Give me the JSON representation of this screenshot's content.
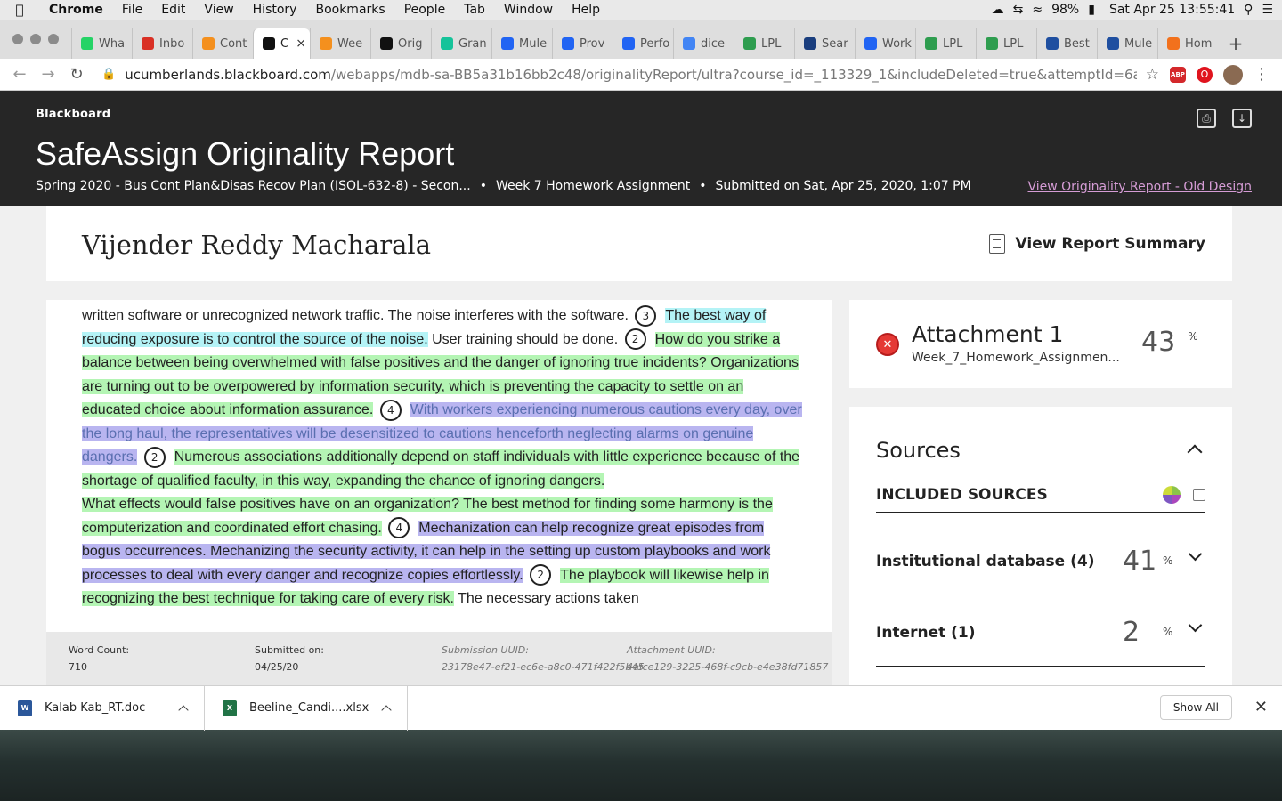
{
  "menubar": {
    "app": "Chrome",
    "items": [
      "File",
      "Edit",
      "View",
      "History",
      "Bookmarks",
      "People",
      "Tab",
      "Window",
      "Help"
    ],
    "battery": "98%",
    "datetime": "Sat Apr 25  13:55:41"
  },
  "tabs": [
    {
      "label": "Wha",
      "icon": "whatsapp-icon",
      "color": "#25d366"
    },
    {
      "label": "Inbo",
      "icon": "gmail-icon",
      "color": "#d93025"
    },
    {
      "label": "Cont",
      "icon": "pencil-icon",
      "color": "#f4901e"
    },
    {
      "label": "C",
      "icon": "blackboard-icon",
      "color": "#111",
      "active": true
    },
    {
      "label": "Wee",
      "icon": "pencil-icon",
      "color": "#f4901e"
    },
    {
      "label": "Orig",
      "icon": "blackboard-icon",
      "color": "#111"
    },
    {
      "label": "Gran",
      "icon": "grammarly-icon",
      "color": "#15c39a"
    },
    {
      "label": "Mule",
      "icon": "indeed-icon",
      "color": "#2164f3"
    },
    {
      "label": "Prov",
      "icon": "indeed-icon",
      "color": "#2164f3"
    },
    {
      "label": "Perfo",
      "icon": "indeed-icon",
      "color": "#2164f3"
    },
    {
      "label": "dice",
      "icon": "google-icon",
      "color": "#4285f4"
    },
    {
      "label": "LPL",
      "icon": "lpl-icon",
      "color": "#2e9d4f"
    },
    {
      "label": "Sear",
      "icon": "chart-icon",
      "color": "#1a3e7e"
    },
    {
      "label": "Work",
      "icon": "indeed-icon",
      "color": "#2164f3"
    },
    {
      "label": "LPL",
      "icon": "lpl-icon",
      "color": "#2e9d4f"
    },
    {
      "label": "LPL",
      "icon": "lpl-icon",
      "color": "#2e9d4f"
    },
    {
      "label": "Best",
      "icon": "dice-icon",
      "color": "#1f4fa0"
    },
    {
      "label": "Mule",
      "icon": "dice-icon",
      "color": "#1f4fa0"
    },
    {
      "label": "Hom",
      "icon": "hom-icon",
      "color": "#f2711c"
    }
  ],
  "address": {
    "host": "ucumberlands.blackboard.com",
    "path": "/webapps/mdb-sa-BB5a31b16bb2c48/originalityReport/ultra?course_id=_113329_1&includeDeleted=true&attemptId=6a346c14-f60b..."
  },
  "header": {
    "brand": "Blackboard",
    "title": "SafeAssign Originality Report",
    "course": "Spring 2020 - Bus Cont Plan&Disas Recov Plan (ISOL-632-8) - Secon...",
    "assignment": "Week 7 Homework Assignment",
    "submitted": "Submitted on Sat, Apr 25, 2020, 1:07 PM",
    "old_design_link": "View Originality Report - Old Design"
  },
  "student": {
    "name": "Vijender Reddy Macharala",
    "summary_label": "View Report Summary"
  },
  "paper": {
    "seg1": "written software or unrecognized network traffic. The noise interferes with the software.",
    "b1": "3",
    "seg2": "The best way of reducing exposure is to control the source of the noise.",
    "seg3": " User training should be done.",
    "b2": "2",
    "seg4": "How do you strike a balance between being overwhelmed with false positives and the danger of ignoring true incidents? Organizations are turning out to be overpowered by information security, which is preventing the capacity to settle on an educated choice about information assurance.",
    "b3": "4",
    "seg5": "With workers experiencing numerous cautions every day, over the long haul, the representatives will be desensitized to cautions henceforth ne­glecting alarms on genuine dangers.",
    "b4": "2",
    "seg6": "Numerous associations additionally depend on staff individuals with little experience because of the shortage of qualified faculty, in this way, expanding the chance of ig­noring dangers.",
    "seg7": "What effects would false positives have on an organization? The best method for finding some harmony is the computerization and coordinated effort chasing.",
    "b5": "4",
    "seg8": "Mechanization can help recognize great episodes from bogus occurrences. Mechanizing the security activity, it can help in the setting up custom playbooks and work processes to deal with every danger and recognize copies effortlessly.",
    "b6": "2",
    "seg9": "The playbook will likewise help in recognizing the best technique for taking care of every risk.",
    "seg10": " The necessary actions taken"
  },
  "footer": {
    "word_count_label": "Word Count:",
    "word_count": "710",
    "submitted_label": "Submitted on:",
    "submitted": "04/25/20",
    "submission_uuid_label": "Submission UUID:",
    "submission_uuid": "23178e47-ef21-ec6e-a8c0-471f422f5b45",
    "attachment_uuid_label": "Attachment UUID:",
    "attachment_uuid": "4afce129-3225-468f-c9cb-e4e38fd71857"
  },
  "attachment": {
    "title": "Attachment 1",
    "file": "Week_7_Homework_Assignmen...",
    "percent": "43",
    "percent_symbol": "%"
  },
  "sources": {
    "title": "Sources",
    "included_label": "INCLUDED SOURCES",
    "rows": [
      {
        "name": "Institutional database (4)",
        "percent": "41",
        "symbol": "%"
      },
      {
        "name": "Internet (1)",
        "percent": "2",
        "symbol": "%"
      }
    ]
  },
  "downloads": {
    "items": [
      {
        "name": "Kalab Kab_RT.doc",
        "icon": "word-doc-icon",
        "color": "#2b579a"
      },
      {
        "name": "Beeline_Candi....xlsx",
        "icon": "excel-icon",
        "color": "#217346"
      }
    ],
    "show_all": "Show All"
  }
}
